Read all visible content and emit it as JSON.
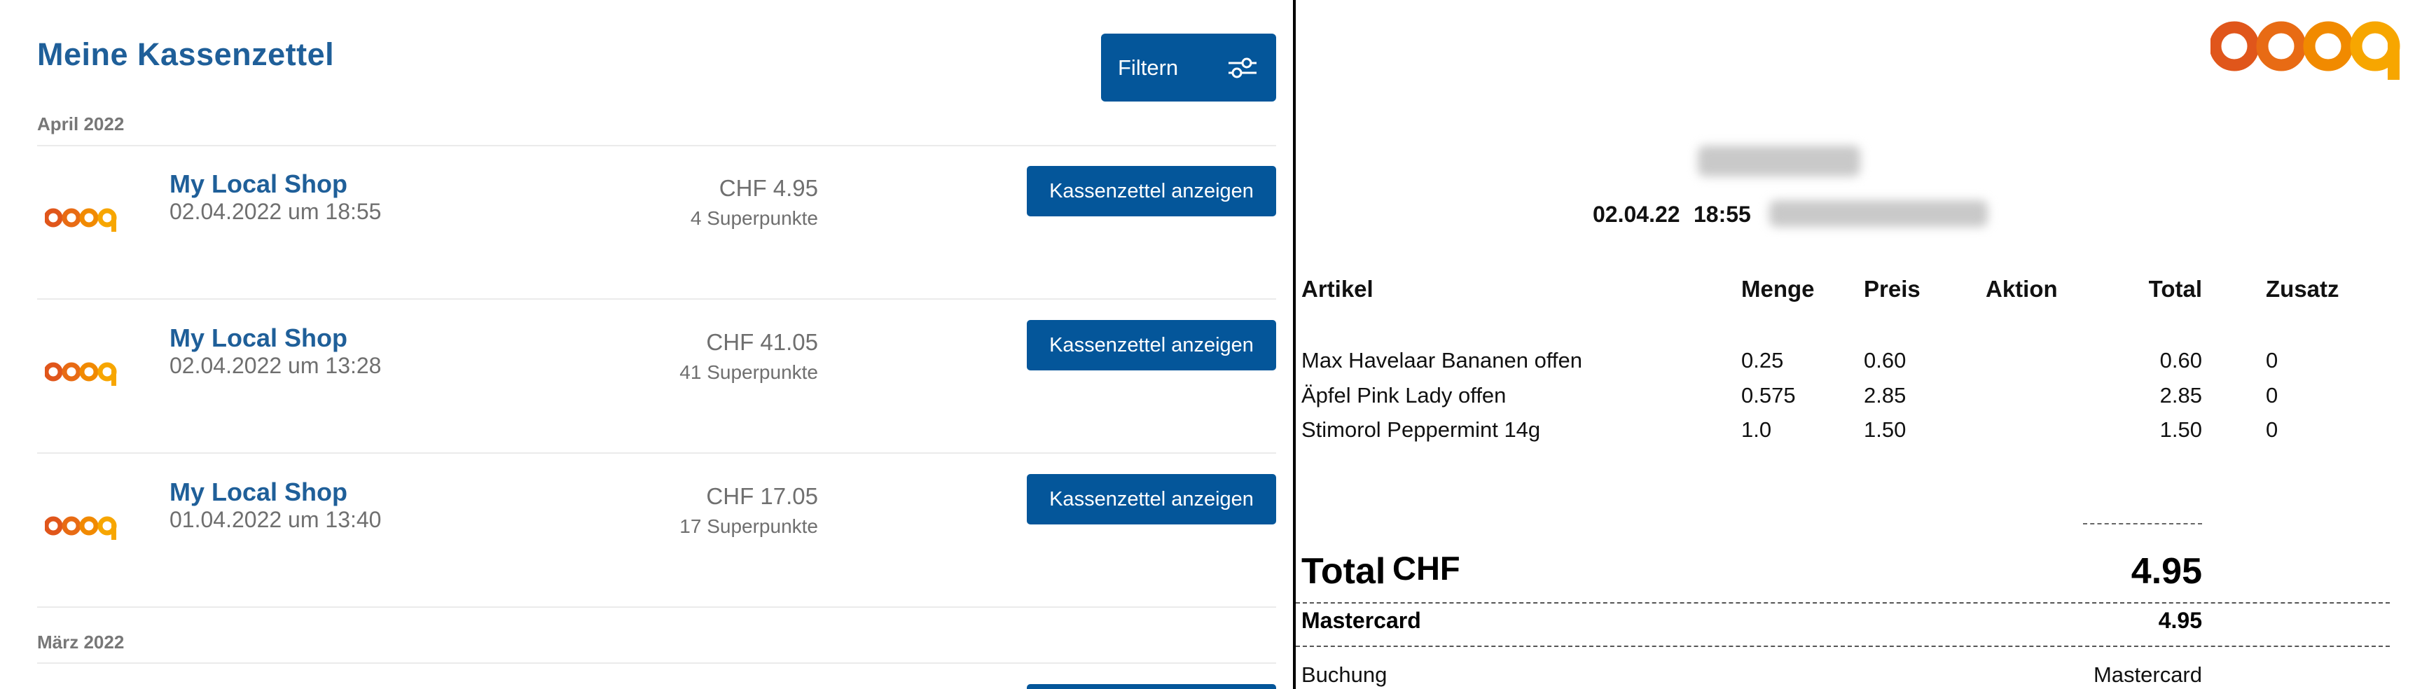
{
  "left": {
    "title": "Meine Kassenzettel",
    "filter_label": "Filtern",
    "filter_icon": "sliders-icon",
    "months": [
      {
        "label": "April 2022",
        "receipts": [
          {
            "shop": "My Local Shop",
            "date": "02.04.2022 um 18:55",
            "amount": "CHF 4.95",
            "points": "4 Superpunkte",
            "button": "Kassenzettel anzeigen",
            "logo": "coop"
          },
          {
            "shop": "My Local Shop",
            "date": "02.04.2022 um 13:28",
            "amount": "CHF 41.05",
            "points": "41 Superpunkte",
            "button": "Kassenzettel anzeigen",
            "logo": "coop"
          },
          {
            "shop": "My Local Shop",
            "date": "01.04.2022 um 13:40",
            "amount": "CHF 17.05",
            "points": "17 Superpunkte",
            "button": "Kassenzettel anzeigen",
            "logo": "coop"
          }
        ]
      },
      {
        "label": "März 2022",
        "receipts": []
      }
    ]
  },
  "receipt": {
    "logo_text": "coop",
    "date": "02.04.22",
    "time": "18:55",
    "columns": {
      "article": "Artikel",
      "qty": "Menge",
      "price": "Preis",
      "action": "Aktion",
      "total": "Total",
      "extra": "Zusatz"
    },
    "items": [
      {
        "article": "Max Havelaar Bananen offen",
        "qty": "0.25",
        "price": "0.60",
        "total": "0.60",
        "extra": "0"
      },
      {
        "article": "Äpfel Pink Lady offen",
        "qty": "0.575",
        "price": "2.85",
        "total": "2.85",
        "extra": "0"
      },
      {
        "article": "Stimorol Peppermint 14g",
        "qty": "1.0",
        "price": "1.50",
        "total": "1.50",
        "extra": "0"
      }
    ],
    "total_label": "Total",
    "currency": "CHF",
    "total_amount": "4.95",
    "payment_method": "Mastercard",
    "payment_amount": "4.95",
    "booking_label": "Buchung",
    "booking_value": "Mastercard"
  },
  "colors": {
    "brand_blue": "#04569a",
    "title_blue": "#1f5f99",
    "coop_orange": "#f18a00",
    "coop_red": "#e0561b"
  }
}
